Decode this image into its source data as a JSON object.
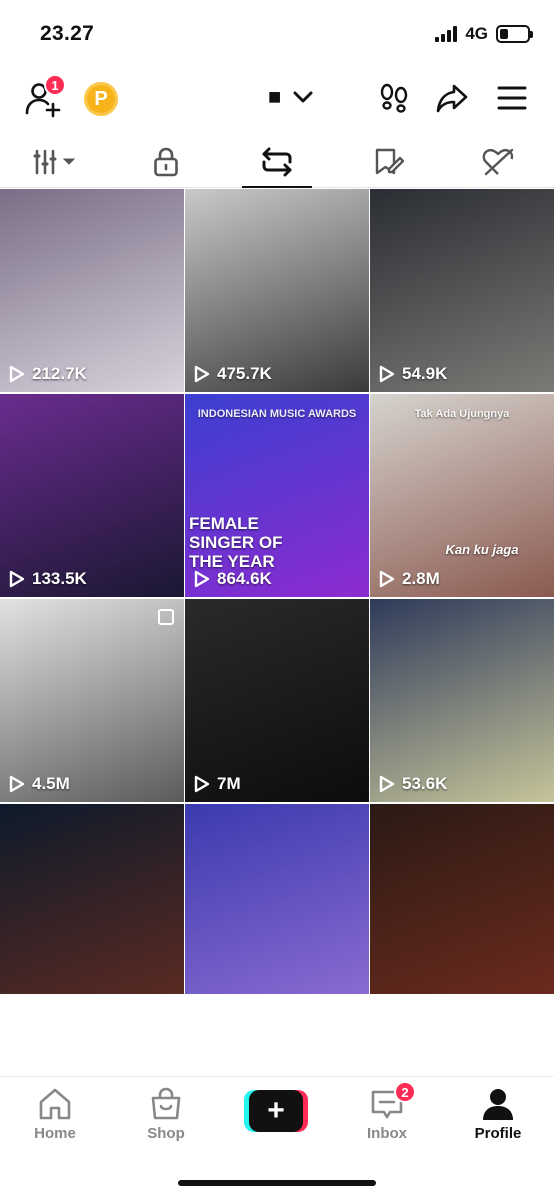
{
  "status_bar": {
    "time": "23.27",
    "network": "4G",
    "battery_level": 0.3
  },
  "header": {
    "add_friend_badge": "1",
    "coin_label": "P",
    "account_name": "■",
    "icons": [
      "add-friend-icon",
      "coin-icon",
      "chevron-down-icon",
      "footprints-icon",
      "share-icon",
      "menu-icon"
    ]
  },
  "tabs": [
    {
      "icon": "grid-sort-icon",
      "active": false
    },
    {
      "icon": "lock-icon",
      "active": false
    },
    {
      "icon": "repost-icon",
      "active": true
    },
    {
      "icon": "bookmark-icon",
      "active": false
    },
    {
      "icon": "liked-icon",
      "active": false
    }
  ],
  "videos": [
    {
      "views": "212.7K",
      "colors": [
        "#7a6e86",
        "#d8d2dc"
      ]
    },
    {
      "views": "475.7K",
      "colors": [
        "#c9c9c9",
        "#3a3a3a"
      ]
    },
    {
      "views": "54.9K",
      "colors": [
        "#2a2d33",
        "#7c7a76"
      ]
    },
    {
      "views": "133.5K",
      "colors": [
        "#6a2c8f",
        "#1a1732"
      ]
    },
    {
      "views": "864.6K",
      "colors": [
        "#3b3fd1",
        "#8d2bd0"
      ],
      "overlay": "FEMALE SINGER OF THE YEAR",
      "overlay_top": "INDONESIAN MUSIC AWARDS"
    },
    {
      "views": "2.8M",
      "colors": [
        "#d6d3ce",
        "#8b5a50"
      ],
      "overlay": "Kan ku jaga",
      "overlay_top": "Tak Ada Ujungnya"
    },
    {
      "views": "4.5M",
      "colors": [
        "#e2e2e2",
        "#5b5b5b"
      ],
      "multi": true
    },
    {
      "views": "7M",
      "colors": [
        "#2a2a2a",
        "#0c0c0c"
      ]
    },
    {
      "views": "53.6K",
      "colors": [
        "#2e3a5a",
        "#c6c49a"
      ]
    },
    {
      "views": "",
      "colors": [
        "#0d1a2b",
        "#5a2a22"
      ]
    },
    {
      "views": "",
      "colors": [
        "#3a3ab0",
        "#8a6ad0"
      ]
    },
    {
      "views": "",
      "colors": [
        "#2a1a14",
        "#6b2a1e"
      ]
    }
  ],
  "bottom_nav": {
    "home": "Home",
    "shop": "Shop",
    "inbox": "Inbox",
    "inbox_badge": "2",
    "profile": "Profile"
  }
}
